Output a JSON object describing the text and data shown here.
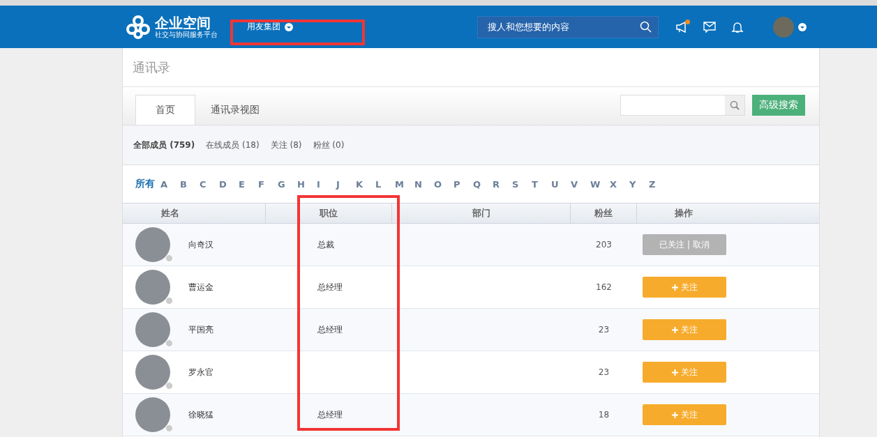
{
  "header": {
    "logo_title": "企业空间",
    "logo_subtitle": "社交与协同服务平台",
    "org": "用友集团",
    "search": {
      "placeholder": "搜人和您想要的内容"
    }
  },
  "page_title": "通讯录",
  "tabs": [
    {
      "label": "首页",
      "selected": true
    },
    {
      "label": "通讯录视图",
      "selected": false
    }
  ],
  "advanced_search": "高级搜索",
  "filters": [
    {
      "label": "全部成员",
      "count": "(759)",
      "selected": true
    },
    {
      "label": "在线成员",
      "count": "(18)",
      "selected": false
    },
    {
      "label": "关注",
      "count": "(8)",
      "selected": false
    },
    {
      "label": "粉丝",
      "count": "(0)",
      "selected": false
    }
  ],
  "letters": [
    {
      "label": "所有",
      "selected": true
    },
    {
      "label": "A",
      "selected": false
    },
    {
      "label": "B",
      "selected": false
    },
    {
      "label": "C",
      "selected": false
    },
    {
      "label": "D",
      "selected": false
    },
    {
      "label": "E",
      "selected": false
    },
    {
      "label": "F",
      "selected": false
    },
    {
      "label": "G",
      "selected": false
    },
    {
      "label": "H",
      "selected": false
    },
    {
      "label": "I",
      "selected": false
    },
    {
      "label": "J",
      "selected": false
    },
    {
      "label": "K",
      "selected": false
    },
    {
      "label": "L",
      "selected": false
    },
    {
      "label": "M",
      "selected": false
    },
    {
      "label": "N",
      "selected": false
    },
    {
      "label": "O",
      "selected": false
    },
    {
      "label": "P",
      "selected": false
    },
    {
      "label": "Q",
      "selected": false
    },
    {
      "label": "R",
      "selected": false
    },
    {
      "label": "S",
      "selected": false
    },
    {
      "label": "T",
      "selected": false
    },
    {
      "label": "U",
      "selected": false
    },
    {
      "label": "V",
      "selected": false
    },
    {
      "label": "W",
      "selected": false
    },
    {
      "label": "X",
      "selected": false
    },
    {
      "label": "Y",
      "selected": false
    },
    {
      "label": "Z",
      "selected": false
    }
  ],
  "table": {
    "columns": [
      "姓名",
      "职位",
      "部门",
      "粉丝",
      "操作"
    ],
    "rows": [
      {
        "name": "向奇汉",
        "position": "总裁",
        "followers": "203",
        "action": {
          "kind": "followed",
          "label": "已关注 | 取消"
        }
      },
      {
        "name": "曹运金",
        "position": "总经理",
        "followers": "162",
        "action": {
          "kind": "follow",
          "label": "关注"
        }
      },
      {
        "name": "平国亮",
        "position": "总经理",
        "followers": "23",
        "action": {
          "kind": "follow",
          "label": "关注"
        }
      },
      {
        "name": "罗永官",
        "followers": "23",
        "action": {
          "kind": "follow",
          "label": "关注"
        }
      },
      {
        "name": "徐晓猛",
        "position": "总经理",
        "followers": "18",
        "action": {
          "kind": "follow",
          "label": "关注"
        }
      }
    ]
  }
}
